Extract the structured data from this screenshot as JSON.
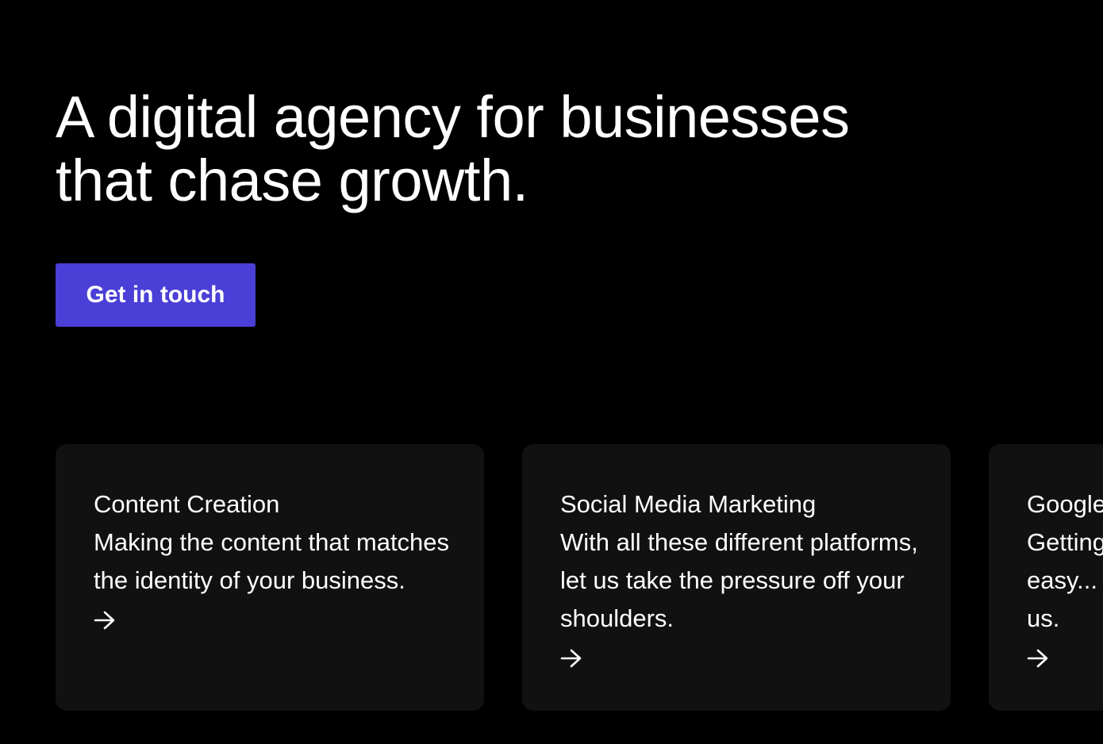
{
  "hero": {
    "title_line1": "A digital agency for businesses",
    "title_line2": "that chase growth.",
    "cta_label": "Get in touch"
  },
  "services": [
    {
      "title": "Content Creation",
      "description": "Making the content that matches the identity of your business.",
      "icon": "arrow-right-icon"
    },
    {
      "title": "Social Media Marketing",
      "description": "With all these different platforms, let us take the pressure off your shoulders.",
      "icon": "arrow-right-icon"
    },
    {
      "title": "Google",
      "description": "Getting easy... us.",
      "icon": "arrow-right-icon"
    }
  ],
  "colors": {
    "background": "#000000",
    "card_background": "#111111",
    "accent": "#4a3fd6",
    "text": "#ffffff"
  }
}
